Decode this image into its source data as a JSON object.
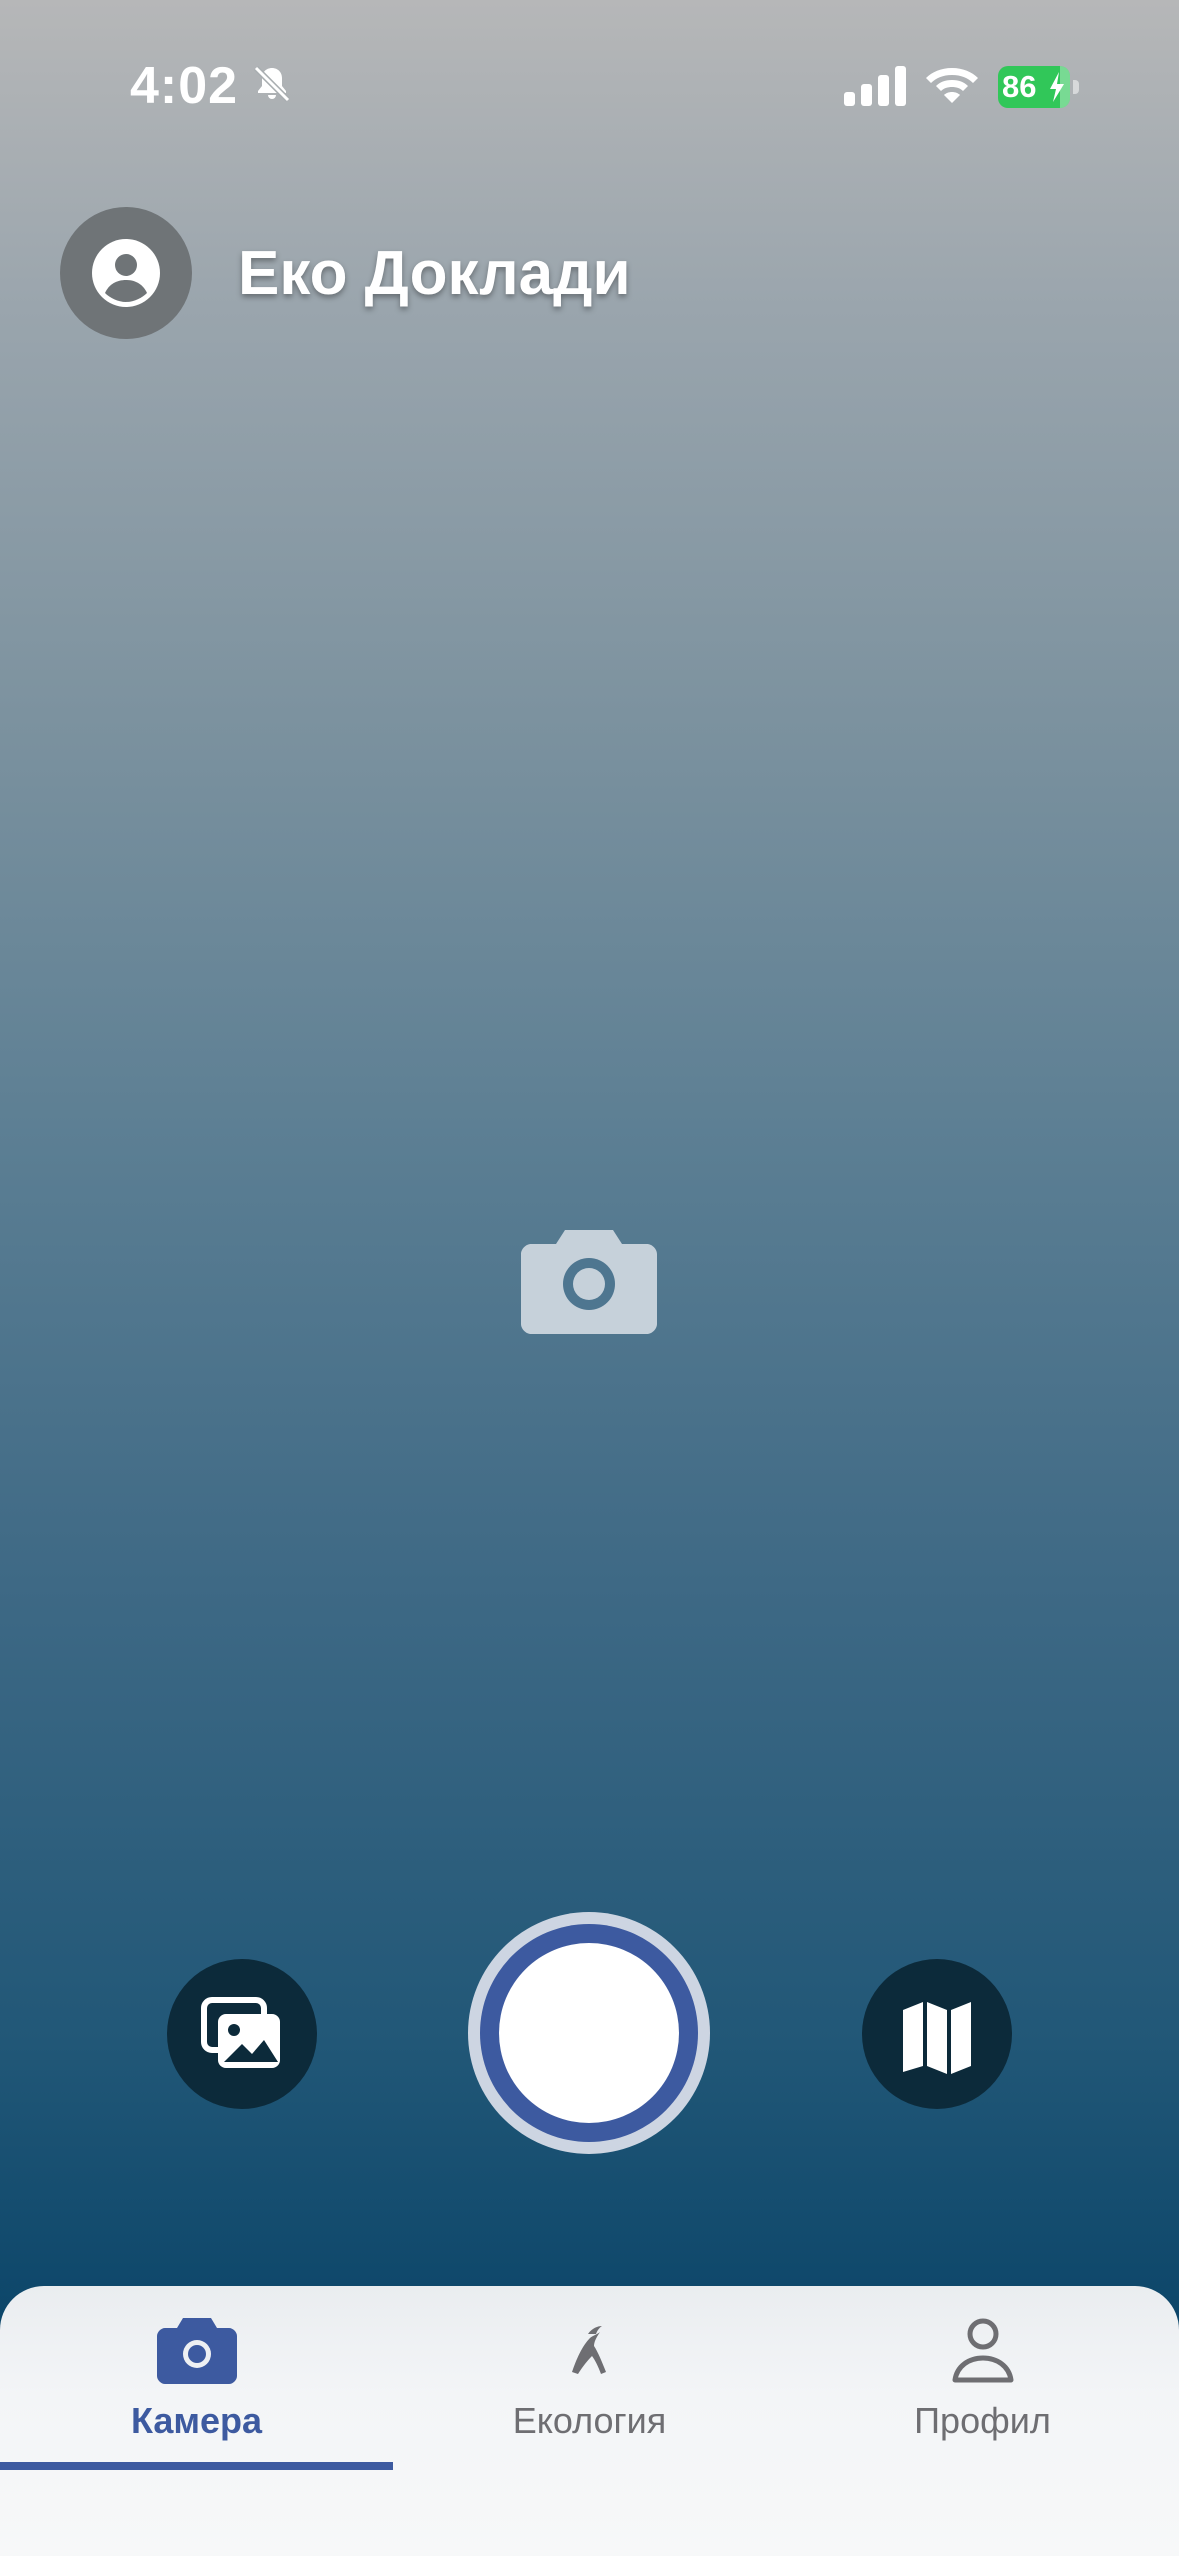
{
  "status_bar": {
    "time": "4:02",
    "battery_level": "86",
    "icons": [
      "bell-slash-icon",
      "cellular-signal-icon",
      "wifi-icon",
      "battery-charging-icon"
    ]
  },
  "header": {
    "title": "Еко Доклади",
    "avatar_icon": "user-circle-icon"
  },
  "main": {
    "placeholder_icon": "camera-icon"
  },
  "controls": {
    "gallery_icon": "gallery-icon",
    "shutter": "shutter-button",
    "map_icon": "map-icon"
  },
  "tabs": [
    {
      "label": "Камера",
      "icon": "camera-icon",
      "active": true
    },
    {
      "label": "Екология",
      "icon": "ecology-icon",
      "active": false
    },
    {
      "label": "Профил",
      "icon": "person-icon",
      "active": false
    }
  ],
  "colors": {
    "accent": "#3d5aa0",
    "battery": "#31c759",
    "control_bg": "#0c2a3a",
    "inactive_tab": "#6e6e72"
  }
}
